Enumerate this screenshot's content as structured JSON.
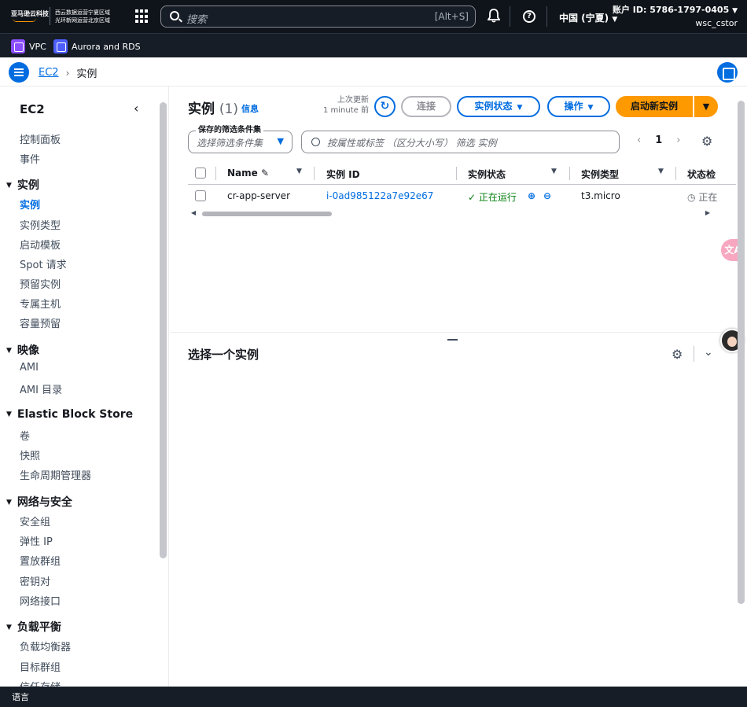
{
  "topbar": {
    "logo_text": "亚马逊云科技",
    "region_note_1": "西云数据运营宁夏区域",
    "region_note_2": "光环新网运营北京区域",
    "search_placeholder": "搜索",
    "search_shortcut": "[Alt+S]",
    "region": "中国 (宁夏)",
    "account_id": "账户 ID: 5786-1797-0405",
    "username": "wsc_cstor"
  },
  "favorites": [
    {
      "label": "VPC"
    },
    {
      "label": "Aurora and RDS"
    }
  ],
  "breadcrumb": {
    "root": "EC2",
    "current": "实例"
  },
  "sidebar": {
    "title": "EC2",
    "items": [
      {
        "label": "控制面板",
        "type": "item"
      },
      {
        "label": "事件",
        "type": "item"
      },
      {
        "label": "实例",
        "type": "section"
      },
      {
        "label": "实例",
        "type": "active"
      },
      {
        "label": "实例类型",
        "type": "item"
      },
      {
        "label": "启动模板",
        "type": "item"
      },
      {
        "label": "Spot 请求",
        "type": "item"
      },
      {
        "label": "预留实例",
        "type": "item"
      },
      {
        "label": "专属主机",
        "type": "item"
      },
      {
        "label": "容量预留",
        "type": "item"
      },
      {
        "label": "映像",
        "type": "section"
      },
      {
        "label": "AMI",
        "type": "item"
      },
      {
        "label": "AMI 目录",
        "type": "item"
      },
      {
        "label": "Elastic Block Store",
        "type": "section"
      },
      {
        "label": "卷",
        "type": "item"
      },
      {
        "label": "快照",
        "type": "item"
      },
      {
        "label": "生命周期管理器",
        "type": "item"
      },
      {
        "label": "网络与安全",
        "type": "section"
      },
      {
        "label": "安全组",
        "type": "item"
      },
      {
        "label": "弹性 IP",
        "type": "item"
      },
      {
        "label": "置放群组",
        "type": "item"
      },
      {
        "label": "密钥对",
        "type": "item"
      },
      {
        "label": "网络接口",
        "type": "item"
      },
      {
        "label": "负载平衡",
        "type": "section"
      },
      {
        "label": "负载均衡器",
        "type": "item"
      },
      {
        "label": "目标群组",
        "type": "item"
      },
      {
        "label": "信任存储",
        "type": "item"
      }
    ]
  },
  "main": {
    "title": "实例",
    "count": "(1)",
    "info": "信息",
    "last_updated_label": "上次更新",
    "last_updated_value": "1 minute 前",
    "connect": "连接",
    "instance_state": "实例状态",
    "actions": "操作",
    "launch": "启动新实例",
    "saved_filter_label": "保存的筛选条件集",
    "saved_filter_placeholder": "选择筛选条件集",
    "property_search_placeholder": "按属性或标签 （区分大小写） 筛选 实例",
    "page": "1",
    "columns": [
      "Name",
      "实例 ID",
      "实例状态",
      "实例类型",
      "状态检"
    ],
    "rows": [
      {
        "name": "cr-app-server",
        "id": "i-0ad985122a7e92e67",
        "state": "正在运行",
        "type": "t3.micro",
        "check": "正在"
      }
    ],
    "detail_title": "选择一个实例"
  },
  "widgets": {
    "translate": "文A"
  },
  "footer": {
    "language": "语言"
  }
}
